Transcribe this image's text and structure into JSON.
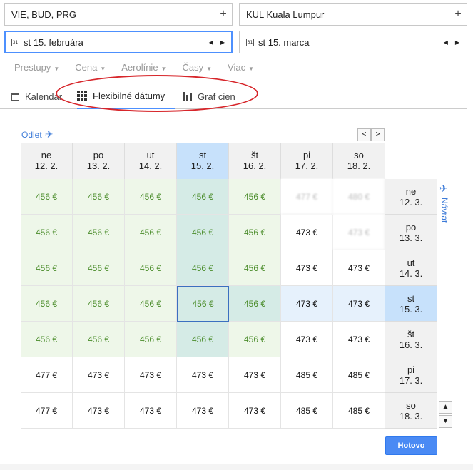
{
  "search": {
    "origin": "VIE, BUD, PRG",
    "dest_code": "KUL",
    "dest_name": "Kuala Lumpur",
    "plus": "+",
    "depart_date": "st 15. februára",
    "return_date": "st 15. marca",
    "cal_icon_text": "31",
    "prev": "◀",
    "next": "▶"
  },
  "filters": [
    "Prestupy",
    "Cena",
    "Aerolínie",
    "Časy",
    "Viac"
  ],
  "tabs": {
    "calendar": "Kalendár",
    "flexible": "Flexibilné dátumy",
    "graph": "Graf cien"
  },
  "grid": {
    "depart_label": "Odlet",
    "return_label": "Návrat",
    "col_days": [
      {
        "d": "ne",
        "date": "12. 2."
      },
      {
        "d": "po",
        "date": "13. 2."
      },
      {
        "d": "ut",
        "date": "14. 2."
      },
      {
        "d": "st",
        "date": "15. 2."
      },
      {
        "d": "št",
        "date": "16. 2."
      },
      {
        "d": "pi",
        "date": "17. 2."
      },
      {
        "d": "so",
        "date": "18. 2."
      }
    ],
    "row_days": [
      {
        "d": "ne",
        "date": "12. 3."
      },
      {
        "d": "po",
        "date": "13. 3."
      },
      {
        "d": "ut",
        "date": "14. 3."
      },
      {
        "d": "st",
        "date": "15. 3."
      },
      {
        "d": "št",
        "date": "16. 3."
      },
      {
        "d": "pi",
        "date": "17. 3."
      },
      {
        "d": "so",
        "date": "18. 3."
      }
    ],
    "prices": [
      [
        "456 €",
        "456 €",
        "456 €",
        "456 €",
        "456 €",
        "477 €",
        "480 €"
      ],
      [
        "456 €",
        "456 €",
        "456 €",
        "456 €",
        "456 €",
        "473 €",
        "473 €"
      ],
      [
        "456 €",
        "456 €",
        "456 €",
        "456 €",
        "456 €",
        "473 €",
        "473 €"
      ],
      [
        "456 €",
        "456 €",
        "456 €",
        "456 €",
        "456 €",
        "473 €",
        "473 €"
      ],
      [
        "456 €",
        "456 €",
        "456 €",
        "456 €",
        "456 €",
        "473 €",
        "473 €"
      ],
      [
        "477 €",
        "473 €",
        "473 €",
        "473 €",
        "473 €",
        "485 €",
        "485 €"
      ],
      [
        "477 €",
        "473 €",
        "473 €",
        "473 €",
        "473 €",
        "485 €",
        "485 €"
      ]
    ]
  },
  "done_label": "Hotovo",
  "colors": {
    "accent": "#4d90fe",
    "cheap_text": "#4a8c2a",
    "highlight": "#d7262b"
  }
}
